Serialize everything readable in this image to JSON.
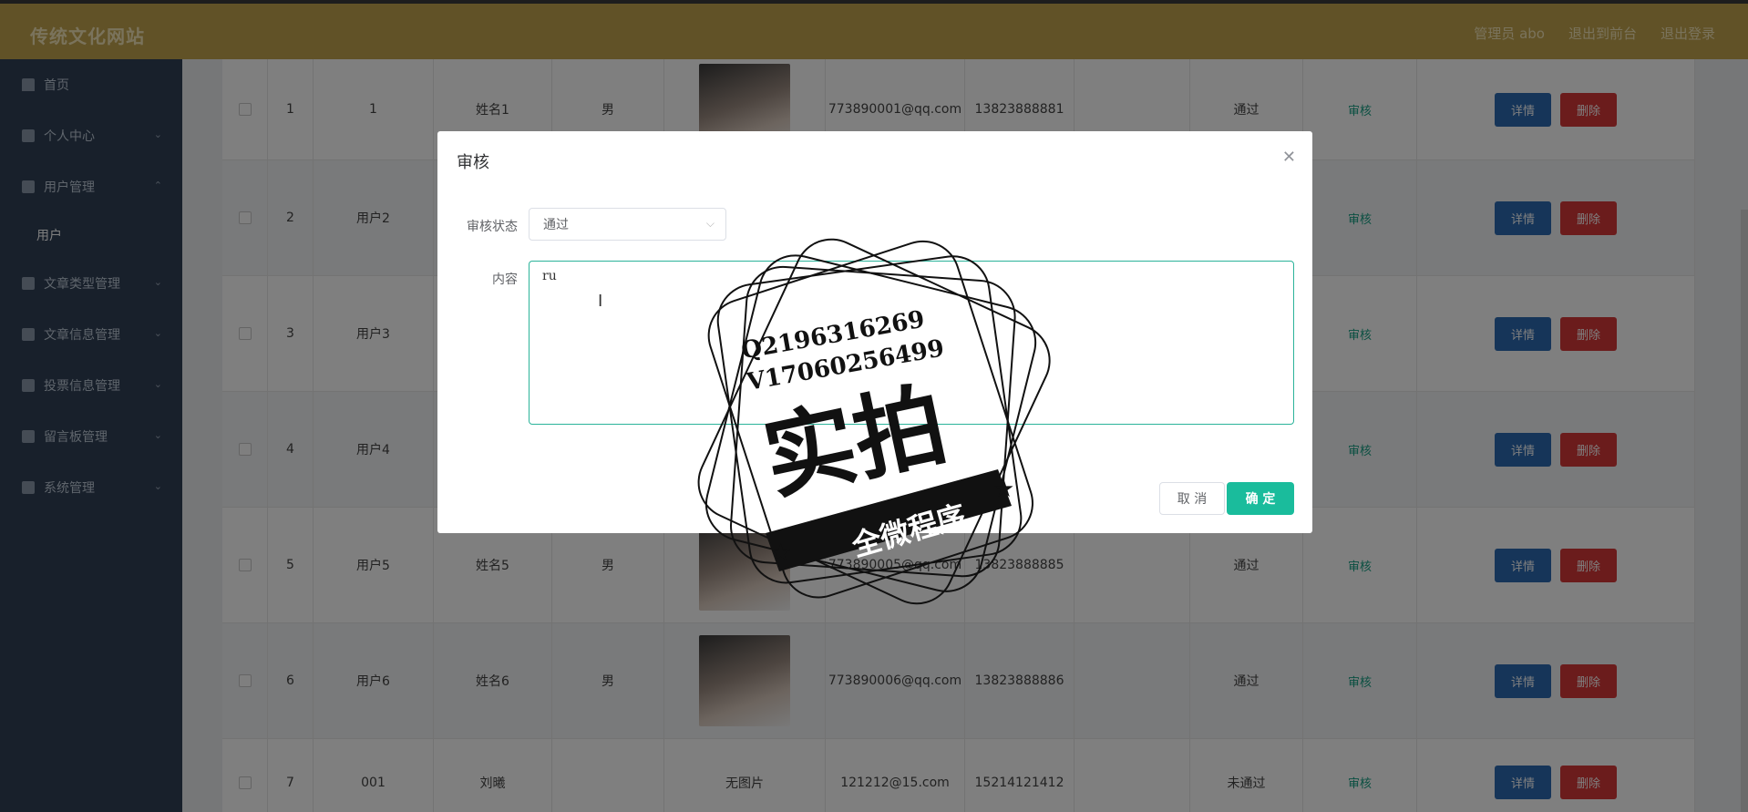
{
  "header": {
    "brand": "传统文化网站",
    "links": [
      "管理员 abo",
      "退出到前台",
      "退出登录"
    ]
  },
  "sidebar": {
    "items": [
      {
        "label": "首页",
        "icon": "home-icon",
        "arrow": ""
      },
      {
        "label": "个人中心",
        "icon": "user-icon",
        "arrow": "⌄"
      },
      {
        "label": "用户管理",
        "icon": "clipboard-icon",
        "arrow": "⌃"
      },
      {
        "label": "用户",
        "sub": true
      },
      {
        "label": "文章类型管理",
        "icon": "copy-icon",
        "arrow": "⌄"
      },
      {
        "label": "文章信息管理",
        "icon": "stamp-icon",
        "arrow": "⌄"
      },
      {
        "label": "投票信息管理",
        "icon": "chart-icon",
        "arrow": "⌄"
      },
      {
        "label": "留言板管理",
        "icon": "stamp-icon",
        "arrow": "⌄"
      },
      {
        "label": "系统管理",
        "icon": "clipboard-icon",
        "arrow": "⌄"
      }
    ]
  },
  "table": {
    "rows": [
      {
        "idx": "1",
        "account": "1",
        "name": "姓名1",
        "gender": "男",
        "photo": "portrait",
        "email": "773890001@qq.com",
        "phone": "13823888881",
        "status": "通过"
      },
      {
        "idx": "2",
        "account": "用户2",
        "name": "",
        "gender": "",
        "photo": "",
        "email": "",
        "phone": "",
        "status": ""
      },
      {
        "idx": "3",
        "account": "用户3",
        "name": "",
        "gender": "",
        "photo": "",
        "email": "",
        "phone": "",
        "status": ""
      },
      {
        "idx": "4",
        "account": "用户4",
        "name": "",
        "gender": "",
        "photo": "",
        "email": "",
        "phone": "",
        "status": ""
      },
      {
        "idx": "5",
        "account": "用户5",
        "name": "姓名5",
        "gender": "男",
        "photo": "portrait",
        "email": "773890005@qq.com",
        "phone": "13823888885",
        "status": "通过"
      },
      {
        "idx": "6",
        "account": "用户6",
        "name": "姓名6",
        "gender": "男",
        "photo": "portrait",
        "email": "773890006@qq.com",
        "phone": "13823888886",
        "status": "通过"
      },
      {
        "idx": "7",
        "account": "001",
        "name": "刘曦",
        "gender": "",
        "photo": "无图片",
        "email": "121212@15.com",
        "phone": "15214121412",
        "status": "未通过"
      }
    ],
    "audit_label": "审核",
    "detail_label": "详情",
    "delete_label": "删除"
  },
  "dialog": {
    "title": "审核",
    "status_label": "审核状态",
    "status_value": "通过",
    "content_label": "内容",
    "content_value": "ru",
    "cancel_label": "取 消",
    "ok_label": "确 定"
  },
  "watermark": {
    "line1": "Q2196316269",
    "line2": "V17060256499",
    "big": "实拍",
    "ribbon": "全微程序"
  }
}
